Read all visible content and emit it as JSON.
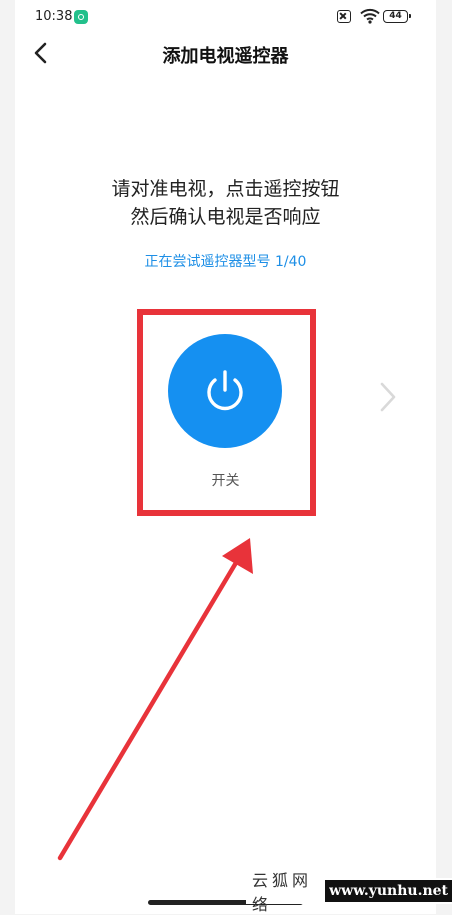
{
  "status_bar": {
    "time": "10:38",
    "battery": "44"
  },
  "header": {
    "title": "添加电视遥控器"
  },
  "instruction": {
    "line1": "请对准电视，点击遥控按钮",
    "line2": "然后确认电视是否响应"
  },
  "trying_text": "正在尝试遥控器型号 1/40",
  "remote": {
    "power_label": "开关"
  },
  "watermark": {
    "site_name": "云狐网络",
    "url": "www.yunhu.net"
  },
  "colors": {
    "accent": "#1590f1",
    "link": "#1e8fe6",
    "annotation": "#e8333a"
  },
  "icons": {
    "back": "chevron-left-icon",
    "power": "power-icon",
    "next": "chevron-right-icon",
    "wifi": "wifi-icon"
  }
}
